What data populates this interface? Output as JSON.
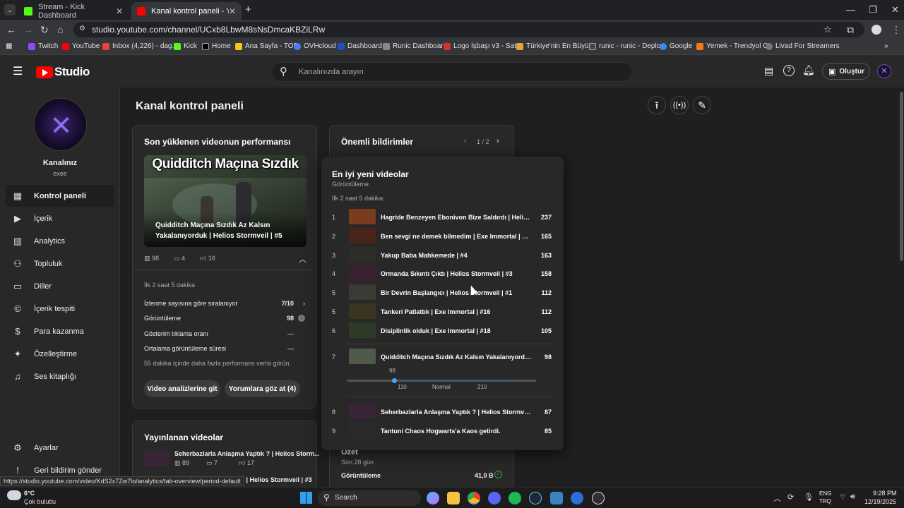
{
  "browser": {
    "tabs": [
      {
        "title": "Stream - Kick Dashboard",
        "color": "#53fc18"
      },
      {
        "title": "Kanal kontrol paneli - YouTube",
        "color": "#ff0000"
      }
    ],
    "url": "studio.youtube.com/channel/UCxb8LbwM8sNsDmcaKBZiLRw",
    "bookmarks": [
      "Twitch",
      "YouTube",
      "Inbox (4,226) - dag...",
      "Kick",
      "Home",
      "Ana Sayfa - TOD",
      "OVHcloud",
      "Dashboard",
      "Runic Dashboard",
      "Logo İşbaşı v3 - Satı...",
      "Türkiye'nin En Büyü...",
      "runic - runic - Deploy",
      "Google",
      "Yemek - Trendyol Go",
      "Livad For Streamers"
    ]
  },
  "header": {
    "logo_text": "Studio",
    "search_placeholder": "Kanalınızda arayın",
    "create_label": "Oluştur"
  },
  "sidebar": {
    "channel_label": "Kanalınız",
    "channel_name": "exee",
    "items": [
      {
        "label": "Kontrol paneli",
        "icon": "dashboard-icon"
      },
      {
        "label": "İçerik",
        "icon": "content-icon"
      },
      {
        "label": "Analytics",
        "icon": "analytics-icon"
      },
      {
        "label": "Topluluk",
        "icon": "community-icon"
      },
      {
        "label": "Diller",
        "icon": "subtitles-icon"
      },
      {
        "label": "İçerik tespiti",
        "icon": "copyright-icon"
      },
      {
        "label": "Para kazanma",
        "icon": "dollar-icon"
      },
      {
        "label": "Özelleştirme",
        "icon": "wand-icon"
      },
      {
        "label": "Ses kitaplığı",
        "icon": "audio-library-icon"
      }
    ],
    "settings": "Ayarlar",
    "feedback": "Geri bildirim gönder"
  },
  "page": {
    "title": "Kanal kontrol paneli"
  },
  "latest": {
    "heading": "Son yüklenen videonun performansı",
    "thumb_title": "Quidditch Maçına Sızdık",
    "video_title": "Quidditch Maçına Sızdık Az Kalsın Yakalanıyorduk | Helios Stormveil | #5",
    "views": "98",
    "comments": "4",
    "likes": "16",
    "period": "İlk 2 saat 5 dakika",
    "rank_label": "İzlenme sayısına göre sıralanıyor",
    "rank_value": "7/10",
    "stats": [
      {
        "label": "Görüntüleme",
        "value": "98"
      },
      {
        "label": "Gösterim tıklama oranı",
        "value": "—"
      },
      {
        "label": "Ortalama görüntüleme süresi",
        "value": "—"
      }
    ],
    "note": "55 dakika içinde daha fazla performans verisi görün.",
    "btn_analytics": "Video analizlerine git",
    "btn_comments": "Yorumlara göz at (4)"
  },
  "published": {
    "heading": "Yayınlanan videolar",
    "item_title": "Seherbazlarla Anlaşma Yaptık ? | Helios Storm...",
    "views": "89",
    "comments": "7",
    "likes": "17",
    "item2_title": "çıktı | Helios Stormveil | #3"
  },
  "notices": {
    "heading": "Önemli bildirimler",
    "pager": "1 / 2"
  },
  "summary": {
    "heading": "Özet",
    "period": "Son 28 gün",
    "label": "Görüntüleme",
    "value": "41,0 B"
  },
  "popup": {
    "title": "En iyi yeni videolar",
    "subtitle": "Görüntüleme",
    "period": "İlk 2 saat 5 dakika:",
    "rows": [
      {
        "rank": "1",
        "title": "Hagride Benzeyen Ebonivon Bize Saldırdı | Helios Sto...",
        "views": "237",
        "color": "#7a3b1e"
      },
      {
        "rank": "2",
        "title": "Ben sevgi ne demek bilmedim | Exe Immortal | #17",
        "views": "165",
        "color": "#4a2418"
      },
      {
        "rank": "3",
        "title": "Yakup Baba Mahkemede | #4",
        "views": "163",
        "color": "#2c2c28"
      },
      {
        "rank": "4",
        "title": "Ormanda Sıkıntı Çıktı | Helios Stormveil | #3",
        "views": "158",
        "color": "#3a2030"
      },
      {
        "rank": "5",
        "title": "Bir Devrin Başlangıcı | Helios Stormveil | #1",
        "views": "112",
        "color": "#3b3a34"
      },
      {
        "rank": "5",
        "title": "Tankeri Patlattık | Exe Immortal | #16",
        "views": "112",
        "color": "#3a3420"
      },
      {
        "rank": "6",
        "title": "Disiplinlik olduk | Exe Immortal | #18",
        "views": "105",
        "color": "#2e3a28"
      },
      {
        "rank": "7",
        "title": "Quidditch Maçına Sızdık Az Kalsın Yakalanıyorduk | H...",
        "views": "98",
        "color": "#4f5a48"
      },
      {
        "rank": "8",
        "title": "Seherbazlarla Anlaşma Yaptık ? | Helios Stormveil | #4",
        "views": "87",
        "color": "#3a2438"
      },
      {
        "rank": "9",
        "title": "Tantuni Chaos Hogwarts'a Kaos getirdi.",
        "views": "85",
        "color": "#2a2a2a"
      }
    ],
    "range": {
      "value": "98",
      "low": "110",
      "mid": "Normal",
      "high": "210"
    }
  },
  "status_url": "https://studio.youtube.com/video/KdS2x7Zw7lo/analytics/tab-overview/period-default",
  "taskbar": {
    "weather_temp": "6°C",
    "weather_desc": "Çok bulutlu",
    "search": "Search",
    "lang1": "ENG",
    "lang2": "TRQ",
    "time": "9:28 PM",
    "date": "12/19/2025"
  }
}
